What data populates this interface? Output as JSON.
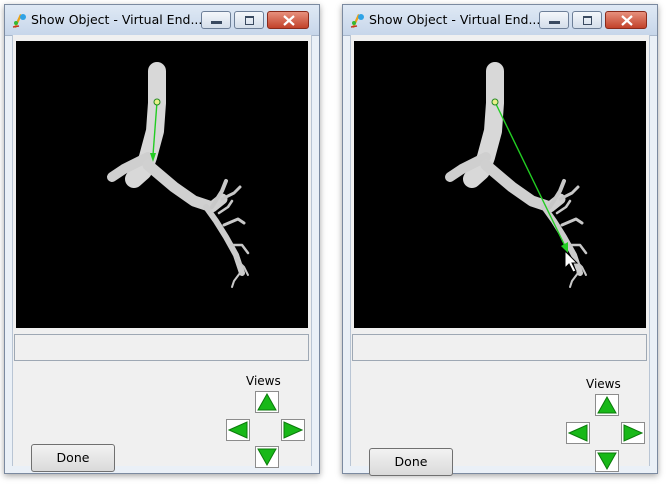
{
  "windows": [
    {
      "title": "Show Object - Virtual End...",
      "views_label": "Views",
      "done_label": "Done",
      "status_text": "",
      "controls": [
        "minimize-icon",
        "maximize-icon",
        "close-icon"
      ],
      "arrows": [
        "arrow-up-icon",
        "arrow-left-icon",
        "arrow-right-icon",
        "arrow-down-icon"
      ]
    },
    {
      "title": "Show Object - Virtual End...",
      "views_label": "Views",
      "done_label": "Done",
      "status_text": "",
      "controls": [
        "minimize-icon",
        "maximize-icon",
        "close-icon"
      ],
      "arrows": [
        "arrow-up-icon",
        "arrow-left-icon",
        "arrow-right-icon",
        "arrow-down-icon"
      ]
    }
  ],
  "colors": {
    "viewport_bg": "#000000",
    "airway": "#dcdcdc",
    "probe_line": "#22cc22",
    "arrow_fill": "#18b818",
    "close_button": "#c2422a"
  }
}
